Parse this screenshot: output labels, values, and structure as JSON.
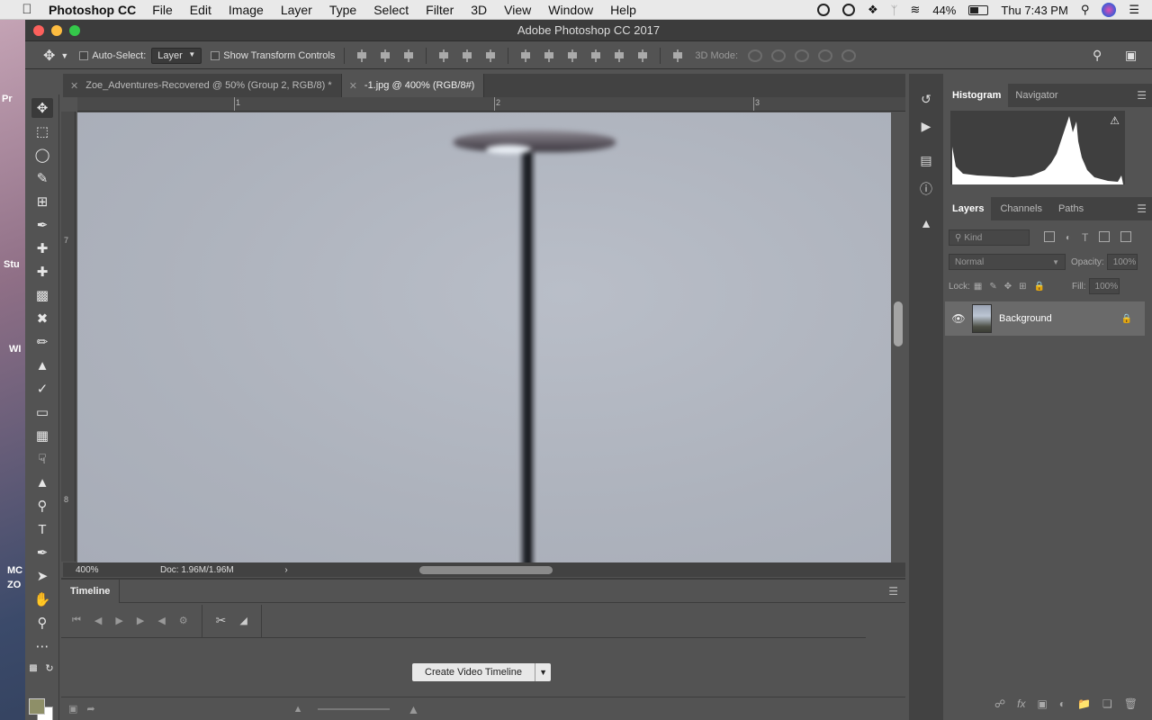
{
  "menubar": {
    "app_name": "Photoshop CC",
    "items": [
      "File",
      "Edit",
      "Image",
      "Layer",
      "Type",
      "Select",
      "Filter",
      "3D",
      "View",
      "Window",
      "Help"
    ],
    "battery": "44%",
    "clock": "Thu 7:43 PM"
  },
  "window": {
    "title": "Adobe Photoshop CC 2017"
  },
  "options": {
    "auto_select_label": "Auto-Select:",
    "auto_select_value": "Layer",
    "transform_label": "Show Transform Controls",
    "mode_3d_label": "3D Mode:"
  },
  "tabs": [
    {
      "label": "Zoe_Adventures-Recovered @ 50% (Group 2, RGB/8) *",
      "active": false
    },
    {
      "label": "-1.jpg @ 400% (RGB/8#)",
      "active": true
    }
  ],
  "rulers": {
    "top_ticks": [
      "1",
      "2",
      "3"
    ],
    "left_ticks": [
      "7",
      "8"
    ]
  },
  "status": {
    "zoom": "400%",
    "doc": "Doc: 1.96M/1.96M"
  },
  "timeline": {
    "title": "Timeline",
    "create_button": "Create Video Timeline"
  },
  "histogram_panel": {
    "tabs": [
      "Histogram",
      "Navigator"
    ]
  },
  "layers_panel": {
    "tabs": [
      "Layers",
      "Channels",
      "Paths"
    ],
    "filter_placeholder": "Kind",
    "blend_mode": "Normal",
    "opacity_label": "Opacity:",
    "opacity_value": "100%",
    "lock_label": "Lock:",
    "fill_label": "Fill:",
    "fill_value": "100%",
    "layers": [
      {
        "name": "Background",
        "visible": true,
        "locked": true
      }
    ]
  },
  "desktop": {
    "peek_labels": [
      "Pr",
      "Stu",
      "WI",
      "MC",
      "ZO"
    ]
  },
  "colors": {
    "foreground": "#8e8f68",
    "background": "#ffffff",
    "ui_gray": "#535353"
  }
}
